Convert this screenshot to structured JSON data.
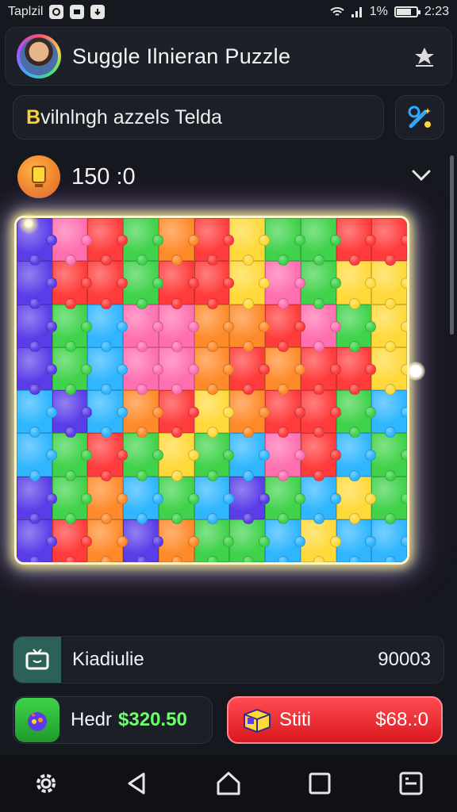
{
  "status_bar": {
    "app_name": "Taplzil",
    "battery_percent": "1%",
    "time": "2:23"
  },
  "header": {
    "title": "Suggle Ilnieran Puzzle",
    "avatar_icon": "user-avatar",
    "action_icon": "pin-icon"
  },
  "search": {
    "lead_letter": "B",
    "text": "vilnlngh azzels Telda"
  },
  "tool_button": {
    "icon": "magic-wand-icon"
  },
  "score": {
    "icon": "trophy-icon",
    "value": "150 :0"
  },
  "board": {
    "columns": 11,
    "rows": 8,
    "palette": [
      "#ff3b3b",
      "#ff8a2a",
      "#ffd93a",
      "#3fd24a",
      "#2fb6ff",
      "#5a3de8",
      "#ff6fb0",
      "#27c28a"
    ],
    "pieces": [
      5,
      6,
      0,
      3,
      1,
      0,
      2,
      3,
      3,
      0,
      0,
      5,
      0,
      0,
      3,
      0,
      0,
      2,
      6,
      3,
      2,
      2,
      5,
      3,
      4,
      6,
      6,
      1,
      1,
      0,
      6,
      3,
      2,
      5,
      3,
      4,
      6,
      6,
      1,
      0,
      1,
      0,
      0,
      2,
      4,
      5,
      4,
      1,
      0,
      2,
      1,
      0,
      0,
      3,
      4,
      4,
      3,
      0,
      3,
      2,
      3,
      4,
      6,
      0,
      4,
      3,
      5,
      3,
      1,
      4,
      3,
      4,
      5,
      3,
      4,
      2,
      3,
      5,
      0,
      1,
      5,
      1,
      3,
      3,
      4,
      2,
      4,
      4
    ]
  },
  "info_row": {
    "icon": "tv-icon",
    "label": "Kiadiulie",
    "value": "90003"
  },
  "hedr_button": {
    "icon": "gem-bag-icon",
    "label": "Hedr",
    "value": "$320.50"
  },
  "stiti_button": {
    "icon": "gift-box-icon",
    "label": "Stiti",
    "value": "$68.:0"
  },
  "nav": [
    "settings-icon",
    "back-icon",
    "home-icon",
    "recents-icon",
    "menu-icon"
  ],
  "colors": {
    "background": "#16181f",
    "accent_green": "#6dff6a",
    "accent_red": "#ff4b52",
    "board_glow": "#ffe27a"
  }
}
